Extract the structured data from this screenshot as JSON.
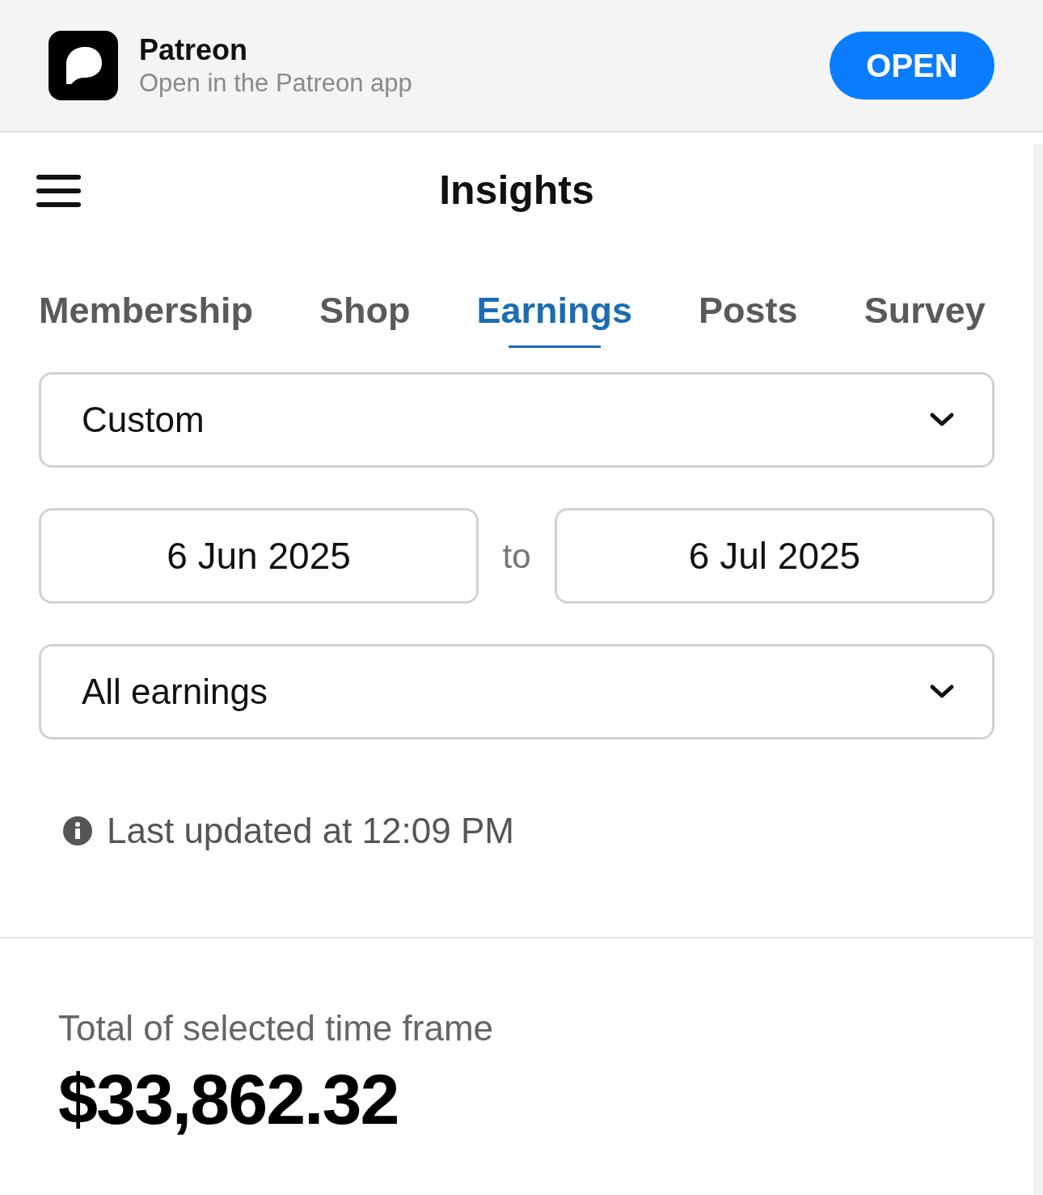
{
  "app_banner": {
    "name": "Patreon",
    "subtitle": "Open in the Patreon app",
    "button": "OPEN"
  },
  "header": {
    "title": "Insights"
  },
  "tabs": [
    {
      "label": "Membership",
      "selected": false
    },
    {
      "label": "Shop",
      "selected": false
    },
    {
      "label": "Earnings",
      "selected": true
    },
    {
      "label": "Posts",
      "selected": false
    },
    {
      "label": "Survey",
      "selected": false
    }
  ],
  "period_select": {
    "value": "Custom"
  },
  "date_range": {
    "start": "6 Jun 2025",
    "separator": "to",
    "end": "6 Jul 2025"
  },
  "type_select": {
    "value": "All earnings"
  },
  "last_updated": "Last updated at 12:09 PM",
  "total": {
    "label": "Total of selected time frame",
    "amount": "$33,862.32"
  }
}
